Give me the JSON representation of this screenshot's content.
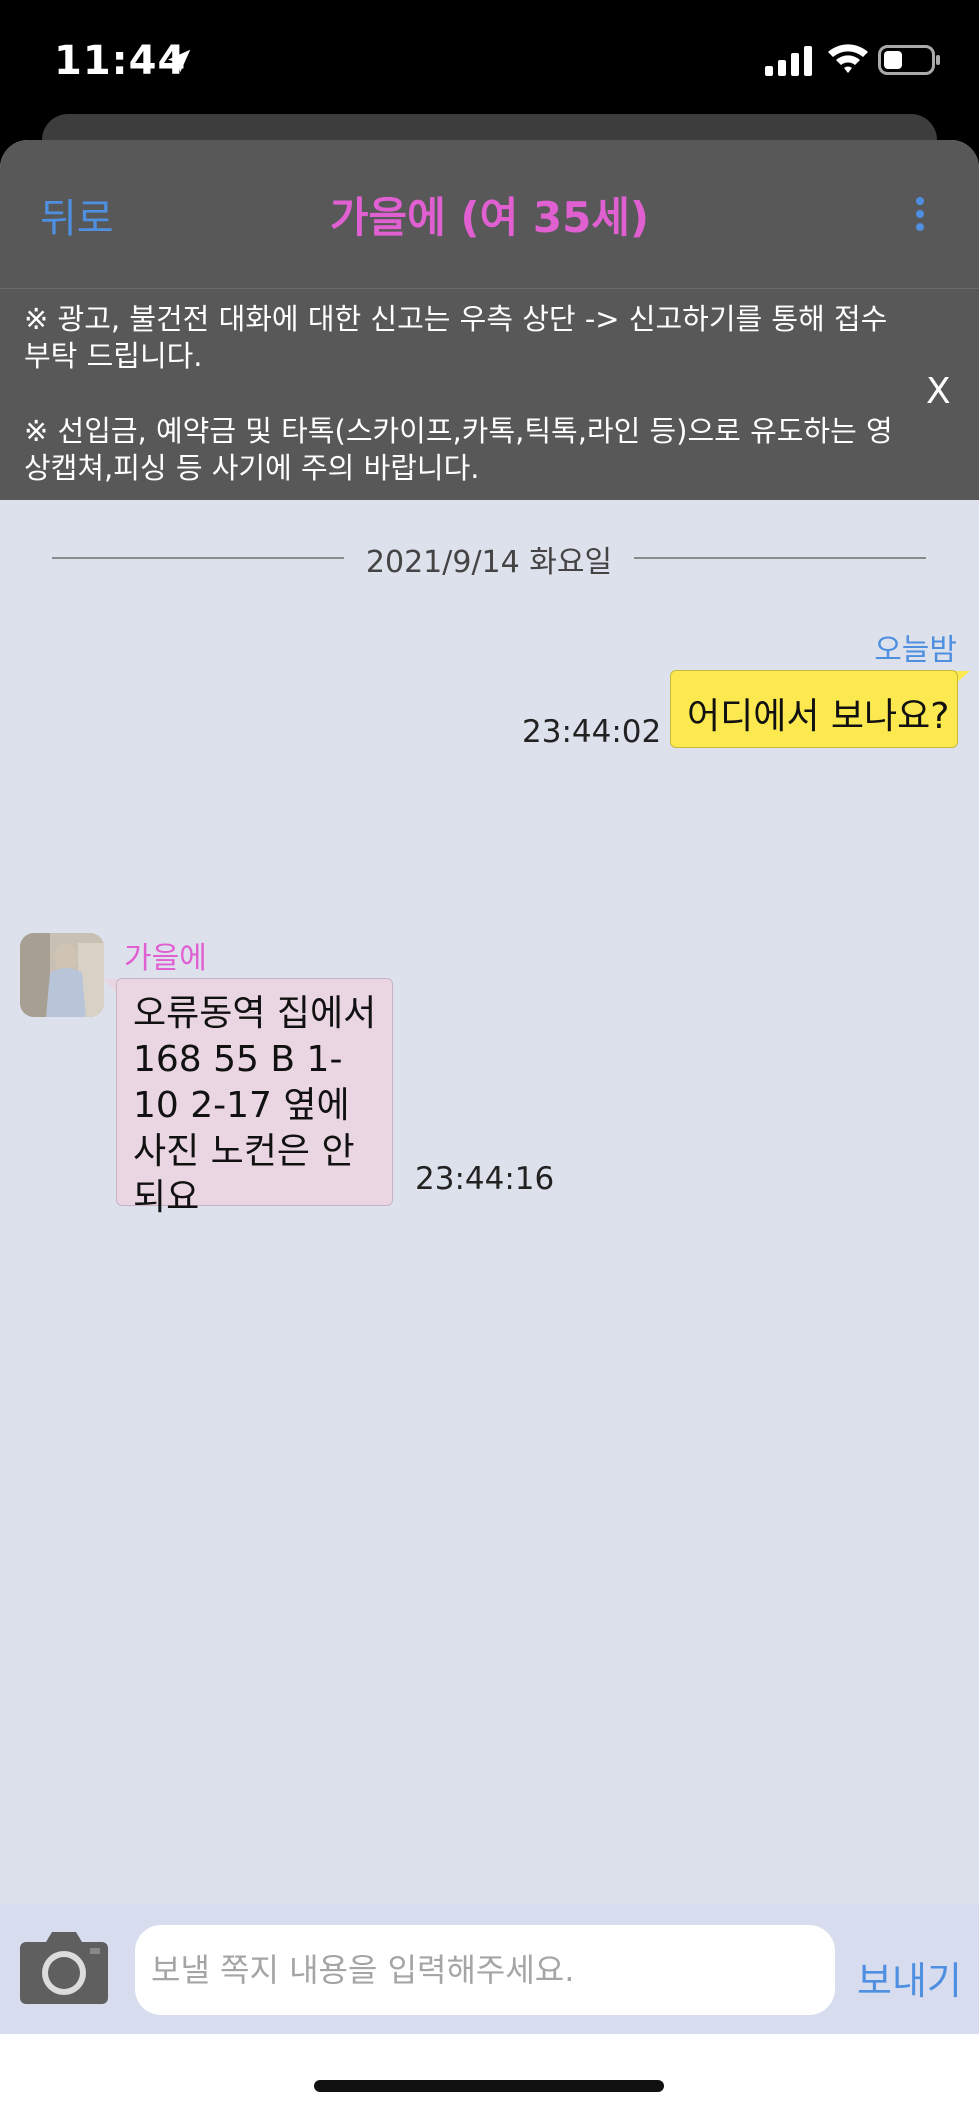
{
  "status_bar": {
    "time": "11:44"
  },
  "header": {
    "back_label": "뒤로",
    "title": "가을에 (여 35세)"
  },
  "notice": {
    "line1": "※ 광고, 불건전 대화에 대한 신고는 우측 상단 -> 신고하기를 통해 접수 부탁 드립니다.",
    "line2": "※ 선입금, 예약금 및 타톡(스카이프,카톡,틱톡,라인 등)으로 유도하는 영상캡쳐,피싱 등 사기에 주의 바랍니다.",
    "close_label": "X"
  },
  "chat": {
    "date": "2021/9/14 화요일",
    "messages": [
      {
        "sender": "오늘밤",
        "text": "어디에서 보나요?",
        "time": "23:44:02"
      },
      {
        "sender": "가을에",
        "text": "오류동역 집에서 168 55 B 1-10 2-17 옆에 사진 노컨은 안 되요",
        "time": "23:44:16"
      }
    ]
  },
  "composer": {
    "placeholder": "보낼 쪽지 내용을 입력해주세요.",
    "send_label": "보내기"
  },
  "colors": {
    "accent_blue": "#4f8fe0",
    "accent_pink": "#e060d2",
    "my_bubble": "#fce94f",
    "their_bubble": "#ead6e2",
    "chat_bg": "#dde1ec"
  }
}
